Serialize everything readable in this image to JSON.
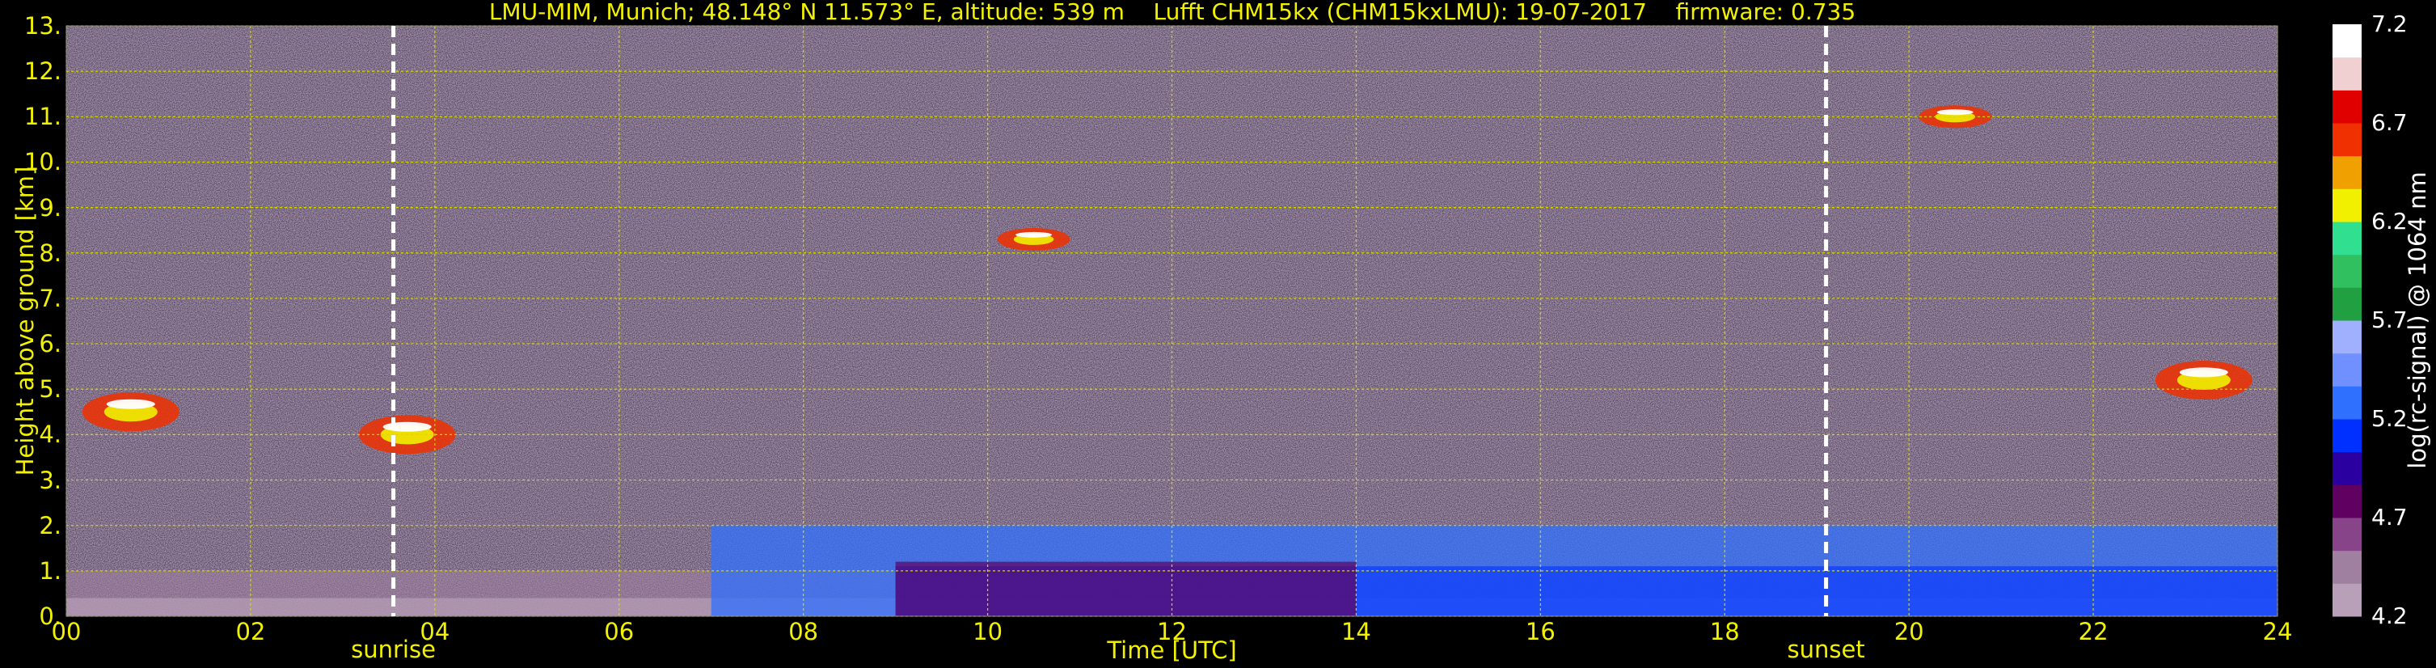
{
  "title": "LMU-MIM, Munich; 48.148° N 11.573° E, altitude: 539 m    Lufft CHM15kx (CHM15kxLMU): 19-07-2017    firmware: 0.735",
  "chart_data": {
    "type": "heatmap",
    "xlabel": "Time [UTC]",
    "ylabel": "Height above ground [km]",
    "xlim": [
      0,
      24
    ],
    "ylim": [
      0,
      13
    ],
    "x_ticks": [
      "00",
      "02",
      "04",
      "06",
      "08",
      "10",
      "12",
      "14",
      "16",
      "18",
      "20",
      "22",
      "24"
    ],
    "x_tick_values": [
      0,
      2,
      4,
      6,
      8,
      10,
      12,
      14,
      16,
      18,
      20,
      22,
      24
    ],
    "y_ticks": [
      "0.",
      "1.",
      "2.",
      "3.",
      "4.",
      "5.",
      "6.",
      "7.",
      "8.",
      "9.",
      "10.",
      "11.",
      "12.",
      "13."
    ],
    "y_tick_values": [
      0,
      1,
      2,
      3,
      4,
      5,
      6,
      7,
      8,
      9,
      10,
      11,
      12,
      13
    ],
    "grid": true,
    "grid_color": "#d8d800",
    "annotations": [
      {
        "label": "sunrise",
        "x": 3.55
      },
      {
        "label": "sunset",
        "x": 19.1
      }
    ],
    "colorbar": {
      "label": "log(rc-signal) @ 1064 nm",
      "ticks": [
        "7.2",
        "6.7",
        "6.2",
        "5.7",
        "5.2",
        "4.7",
        "4.2"
      ],
      "tick_values": [
        7.2,
        6.7,
        6.2,
        5.7,
        5.2,
        4.7,
        4.2
      ],
      "range": [
        4.2,
        7.2
      ],
      "colors": [
        "#b8a0b8",
        "#a080a0",
        "#884488",
        "#600060",
        "#2a00a0",
        "#0030ff",
        "#3070ff",
        "#7090ff",
        "#a0b0ff",
        "#20a040",
        "#30c060",
        "#30e090",
        "#f0f000",
        "#f0a000",
        "#f03000",
        "#e00000",
        "#f0d0d0",
        "#ffffff"
      ]
    },
    "features": [
      {
        "label": "boundary layer",
        "x0": 7,
        "x1": 24,
        "y0": 0,
        "y1": 2
      },
      {
        "label": "cloud",
        "x": 0.7,
        "y": 4.5
      },
      {
        "label": "cloud",
        "x": 3.7,
        "y": 4.0
      },
      {
        "label": "cloud",
        "x": 23.2,
        "y": 5.2
      },
      {
        "label": "cirrus",
        "x": 20.5,
        "y": 11.0
      },
      {
        "label": "cirrus",
        "x": 10.5,
        "y": 8.3
      }
    ]
  }
}
